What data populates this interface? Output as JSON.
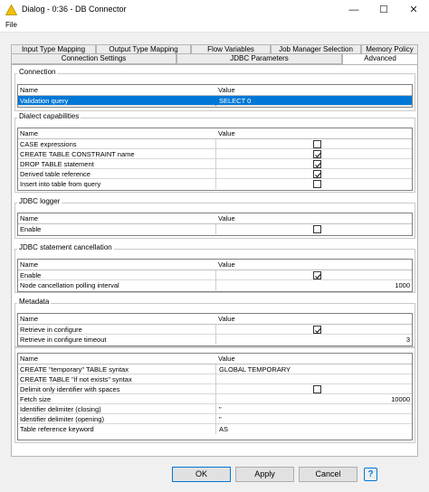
{
  "window": {
    "title": "Dialog - 0:36 - DB Connector",
    "minimize_glyph": "—",
    "maximize_glyph": "☐",
    "close_glyph": "✕"
  },
  "menu": {
    "file": "File"
  },
  "tabs": {
    "back": [
      "Input Type Mapping",
      "Output Type Mapping",
      "Flow Variables",
      "Job Manager Selection",
      "Memory Policy"
    ],
    "front": [
      "Connection Settings",
      "JDBC Parameters",
      "Advanced"
    ],
    "active": "Advanced"
  },
  "columns": {
    "name": "Name",
    "value": "Value"
  },
  "groups": {
    "connection": {
      "title": "Connection",
      "rows": [
        {
          "name": "Validation query",
          "value": "SELECT 0"
        }
      ]
    },
    "dialect": {
      "title": "Dialect capabilities",
      "rows": [
        {
          "name": "CASE expressions",
          "checked": false
        },
        {
          "name": "CREATE TABLE CONSTRAINT name",
          "checked": true
        },
        {
          "name": "DROP TABLE statement",
          "checked": true
        },
        {
          "name": "Derived table reference",
          "checked": true
        },
        {
          "name": "Insert into table from query",
          "checked": false
        }
      ]
    },
    "jdbc_logger": {
      "title": "JDBC logger",
      "rows": [
        {
          "name": "Enable",
          "checked": false
        }
      ]
    },
    "cancellation": {
      "title": "JDBC statement cancellation",
      "rows": [
        {
          "name": "Enable",
          "checked": true
        },
        {
          "name": "Node cancellation polling interval",
          "value": "1000"
        }
      ]
    },
    "metadata": {
      "title": "Metadata",
      "rows": [
        {
          "name": "Retrieve in configure",
          "checked": true
        },
        {
          "name": "Retrieve in configure timeout",
          "value": "3"
        }
      ]
    },
    "misc": {
      "rows": [
        {
          "name": "CREATE \"temporary\" TABLE syntax",
          "value": "GLOBAL TEMPORARY"
        },
        {
          "name": "CREATE TABLE \"if not exists\" syntax",
          "value": ""
        },
        {
          "name": "Delimit only identifier with spaces",
          "checked": false
        },
        {
          "name": "Fetch size",
          "value": "10000"
        },
        {
          "name": "Identifier delimiter (closing)",
          "value": "\""
        },
        {
          "name": "Identifier delimiter (opening)",
          "value": "\""
        },
        {
          "name": "Table reference keyword",
          "value": "AS"
        }
      ]
    }
  },
  "buttons": {
    "ok": "OK",
    "apply": "Apply",
    "cancel": "Cancel",
    "help": "?"
  },
  "colors": {
    "selection": "#0078d7",
    "accent_border": "#0078d7"
  }
}
